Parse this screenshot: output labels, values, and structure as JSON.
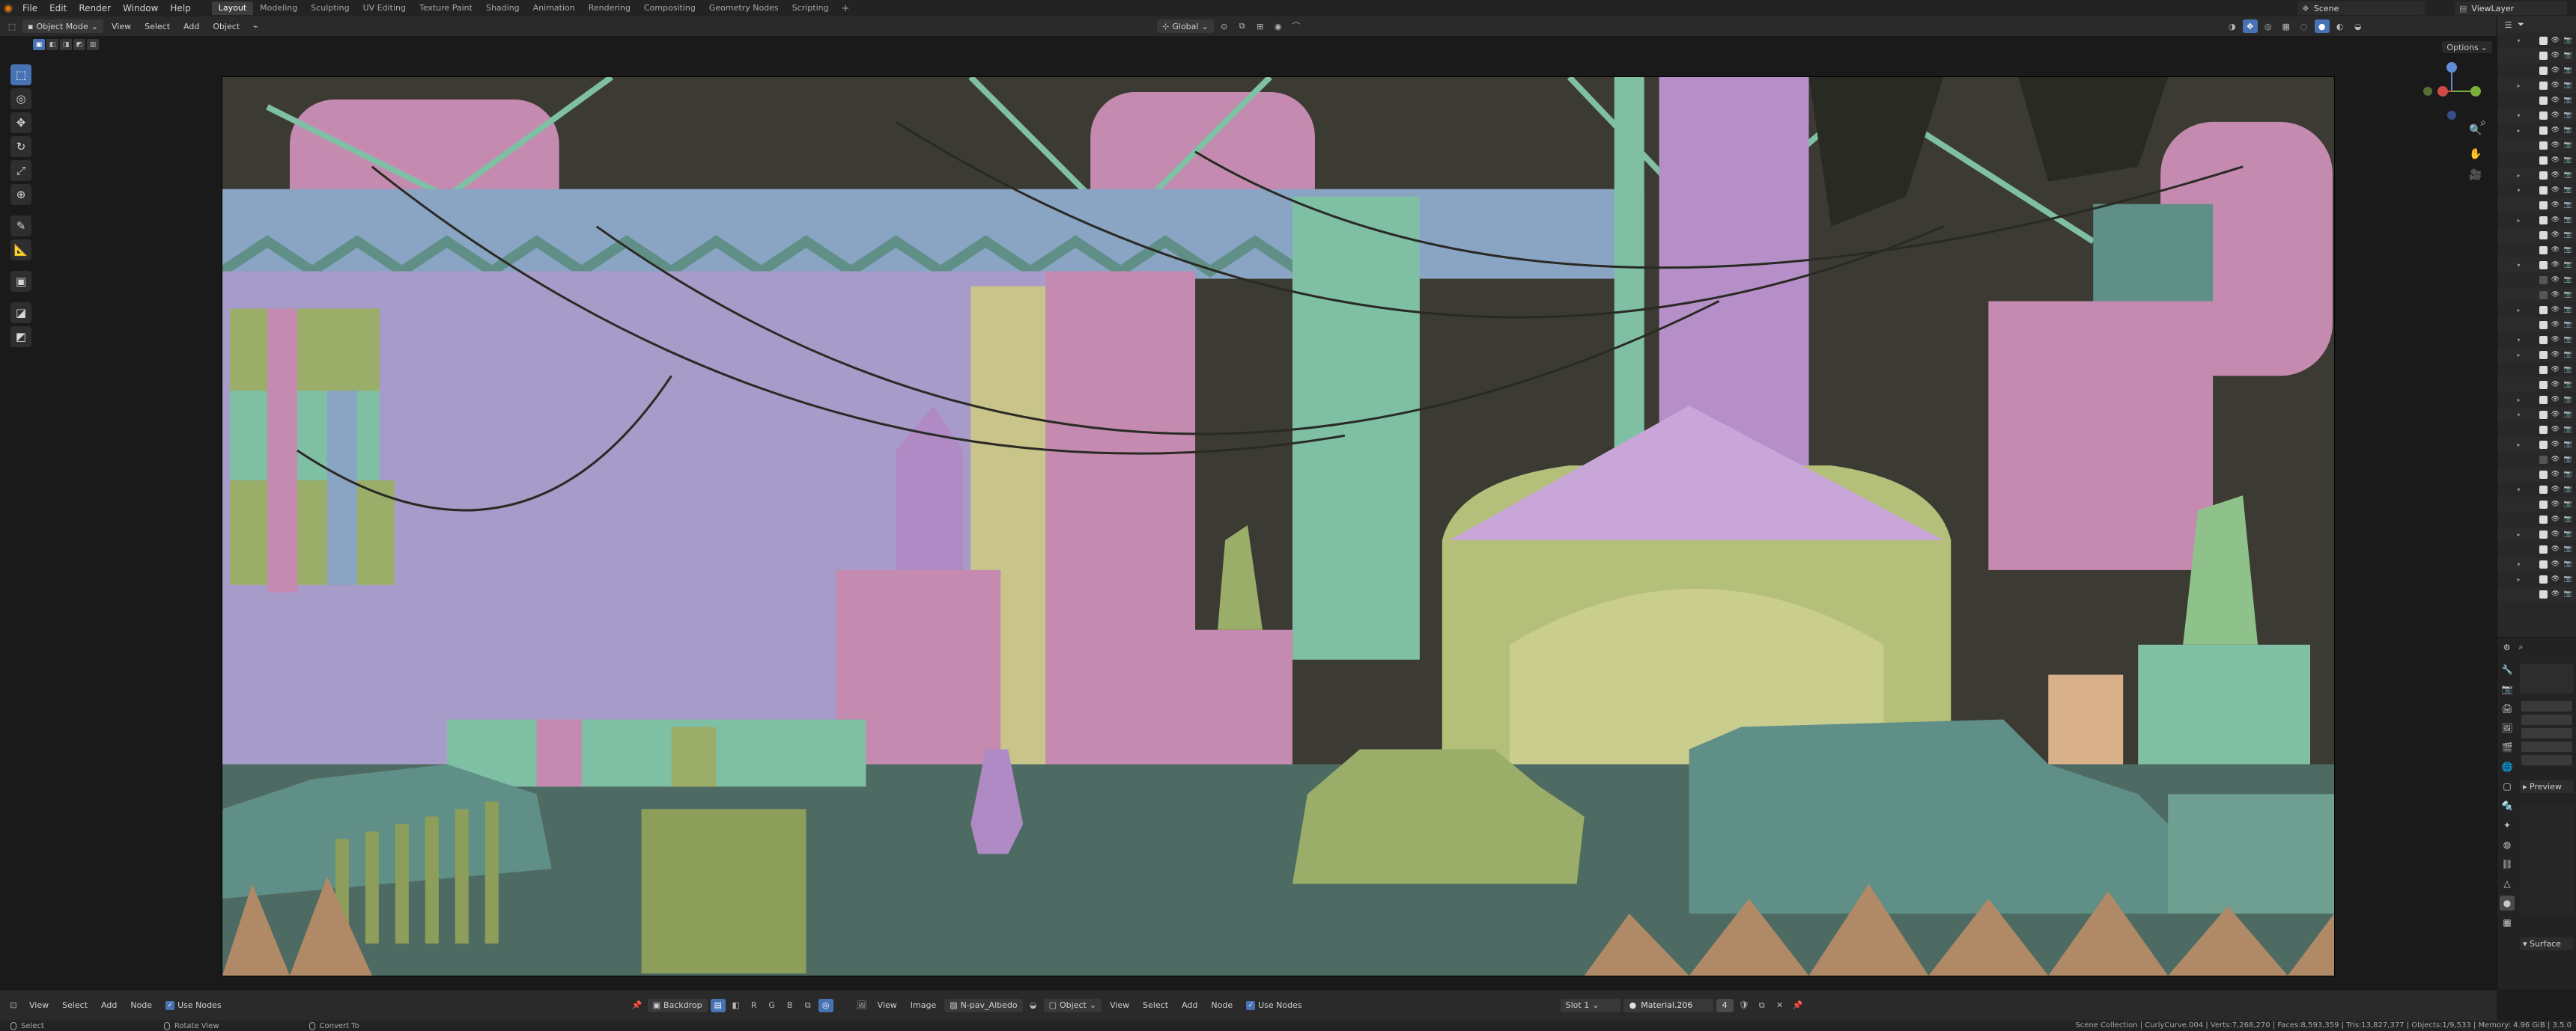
{
  "app": {
    "menus": [
      "File",
      "Edit",
      "Render",
      "Window",
      "Help"
    ],
    "workspaces": [
      "Layout",
      "Modeling",
      "Sculpting",
      "UV Editing",
      "Texture Paint",
      "Shading",
      "Animation",
      "Rendering",
      "Compositing",
      "Geometry Nodes",
      "Scripting"
    ],
    "active_workspace": "Layout",
    "add_workspace": "+",
    "scene": "Scene",
    "view_layer": "ViewLayer"
  },
  "viewport": {
    "mode": "Object Mode",
    "menus": [
      "View",
      "Select",
      "Add",
      "Object"
    ],
    "transform_orientation": "Global",
    "options_label": "Options",
    "select_modes": [
      "▣",
      "◧",
      "◨",
      "◩",
      "▥"
    ],
    "tools": [
      {
        "name": "select-box-tool",
        "glyph": "⬚",
        "active": true
      },
      {
        "name": "cursor-tool",
        "glyph": "◎"
      },
      {
        "name": "move-tool",
        "glyph": "✥"
      },
      {
        "name": "rotate-tool",
        "glyph": "↻"
      },
      {
        "name": "scale-tool",
        "glyph": "⤢"
      },
      {
        "name": "transform-tool",
        "glyph": "⊕"
      },
      {
        "name": "annotate-tool",
        "glyph": "✎"
      },
      {
        "name": "measure-tool",
        "glyph": "📐"
      },
      {
        "name": "add-cube-tool",
        "glyph": "▣"
      },
      {
        "name": "extrude-tool",
        "glyph": "◪"
      },
      {
        "name": "bevel-tool",
        "glyph": "◩"
      }
    ],
    "gizmo": {
      "z": "Z",
      "y": "Y",
      "x": "X"
    }
  },
  "render_colors": {
    "sky": "#3b3a33",
    "wall_lavender": "#a79bc9",
    "pink": "#c48ab0",
    "mint": "#7fbfa4",
    "green": "#9aae6a",
    "teal": "#5f8f86",
    "olive": "#8d9e5a",
    "straw": "#b08a66",
    "dark": "#2a2a24"
  },
  "outliner": {
    "rows": 38
  },
  "properties": {
    "preview_label": "Preview",
    "surface_label": "Surface"
  },
  "node_editor": {
    "header_menus": [
      "View",
      "Select",
      "Add",
      "Node"
    ],
    "use_nodes_label": "Use Nodes",
    "backdrop_label": "Backdrop",
    "image_menus": [
      "View",
      "Image"
    ],
    "image_name": "N-pav_Albedo",
    "object_label": "Object",
    "node_menus": [
      "View",
      "Select",
      "Add",
      "Node"
    ],
    "use_nodes_label_2": "Use Nodes",
    "slot_label": "Slot 1",
    "material_name": "Material.206",
    "user_count": "4"
  },
  "statusbar": {
    "select": "Select",
    "rotate": "Rotate View",
    "convert": "Convert To",
    "stats": "Scene Collection | CurlyCurve.004 | Verts:7,268,270 | Faces:8,593,359 | Tris:13,827,377 | Objects:1/9,533 | Memory: 4.96 GiB | 3.5.0"
  }
}
